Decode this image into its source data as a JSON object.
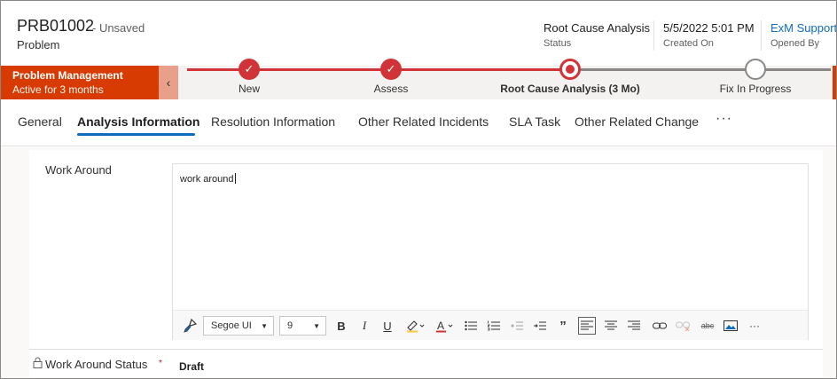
{
  "record": {
    "id": "PRB01002",
    "save_state": "- Unsaved",
    "entity": "Problem"
  },
  "header_fields": [
    {
      "value": "Root Cause Analysis",
      "label": "Status"
    },
    {
      "value": "5/5/2022 5:01 PM",
      "label": "Created On"
    },
    {
      "value": "ExM Support",
      "label": "Opened By"
    }
  ],
  "process": {
    "name": "Problem Management",
    "duration": "Active for 3 months",
    "stages": [
      {
        "label": "New",
        "state": "completed"
      },
      {
        "label": "Assess",
        "state": "completed"
      },
      {
        "label": "Root Cause Analysis  (3 Mo)",
        "state": "active"
      },
      {
        "label": "Fix In Progress",
        "state": "upcoming"
      }
    ]
  },
  "tabs": [
    {
      "label": "General",
      "active": false
    },
    {
      "label": "Analysis Information",
      "active": true
    },
    {
      "label": "Resolution Information",
      "active": false
    },
    {
      "label": "Other Related Incidents",
      "active": false
    },
    {
      "label": "SLA Task",
      "active": false
    },
    {
      "label": "Other Related Change",
      "active": false
    }
  ],
  "tabs_more": "···",
  "form": {
    "work_around": {
      "label": "Work Around",
      "value": "work around"
    },
    "work_around_status": {
      "label": "Work Around Status",
      "required_mark": "*",
      "value": "Draft"
    }
  },
  "editor_toolbar": {
    "font_family": "Segoe UI",
    "font_size": "9",
    "buttons": [
      "format-painter-icon",
      "bold-icon",
      "italic-icon",
      "underline-icon",
      "highlight-icon",
      "font-color-icon",
      "bullet-list-icon",
      "numbered-list-icon",
      "decrease-indent-icon",
      "increase-indent-icon",
      "quote-icon",
      "align-left-icon",
      "align-center-icon",
      "align-right-icon",
      "link-icon",
      "unlink-icon",
      "strikethrough-icon",
      "image-icon",
      "more-icon"
    ]
  },
  "colors": {
    "accent_red": "#d13438",
    "process_orange": "#d83b01",
    "link_blue": "#0f6cbd"
  }
}
